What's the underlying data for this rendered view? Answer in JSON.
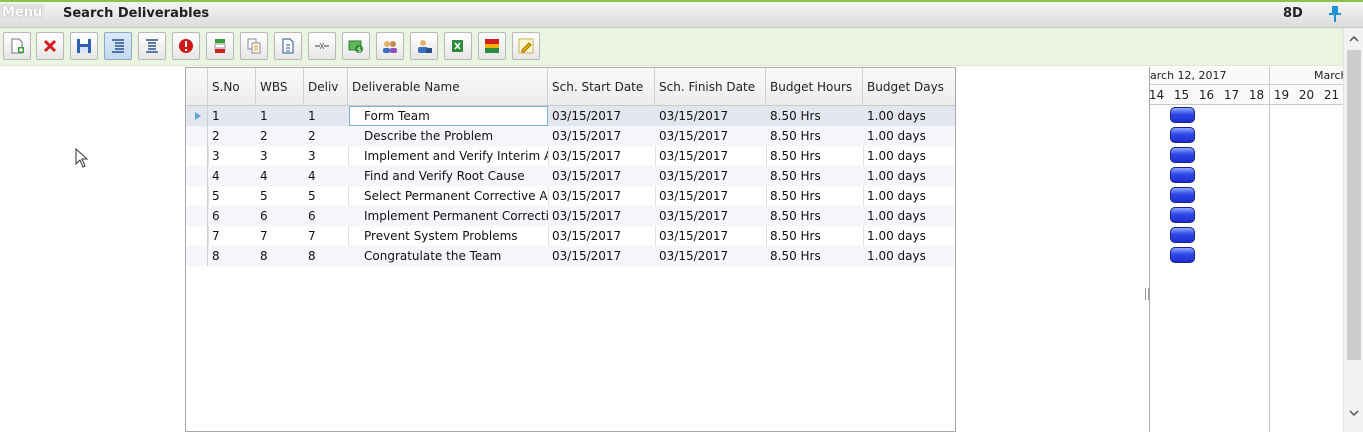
{
  "titlebar": {
    "menu_label": "Menu",
    "title": "Search Deliverables",
    "module": "8D"
  },
  "toolbar": {
    "buttons": [
      {
        "name": "new-icon"
      },
      {
        "name": "delete-icon"
      },
      {
        "name": "save-icon"
      },
      {
        "name": "indent-icon"
      },
      {
        "name": "outdent-icon"
      },
      {
        "name": "alert-icon"
      },
      {
        "name": "insert-row-icon"
      },
      {
        "name": "copy-icon"
      },
      {
        "name": "document-icon"
      },
      {
        "name": "link-icon"
      },
      {
        "name": "money-icon"
      },
      {
        "name": "team-icon"
      },
      {
        "name": "assign-user-icon"
      },
      {
        "name": "export-icon"
      },
      {
        "name": "color-legend-icon"
      },
      {
        "name": "edit-icon"
      }
    ]
  },
  "grid": {
    "columns": [
      "S.No",
      "WBS",
      "Deliv",
      "Deliverable Name",
      "Sch. Start Date",
      "Sch. Finish Date",
      "Budget Hours",
      "Budget Days"
    ],
    "rows": [
      {
        "sno": "1",
        "wbs": "1",
        "deliv": "1",
        "name": "Form Team",
        "start": "03/15/2017",
        "finish": "03/15/2017",
        "hours": "8.50 Hrs",
        "days": "1.00 days"
      },
      {
        "sno": "2",
        "wbs": "2",
        "deliv": "2",
        "name": "Describe the Problem",
        "start": "03/15/2017",
        "finish": "03/15/2017",
        "hours": "8.50 Hrs",
        "days": "1.00 days"
      },
      {
        "sno": "3",
        "wbs": "3",
        "deliv": "3",
        "name": "Implement and Verify Interim Ac",
        "start": "03/15/2017",
        "finish": "03/15/2017",
        "hours": "8.50 Hrs",
        "days": "1.00 days"
      },
      {
        "sno": "4",
        "wbs": "4",
        "deliv": "4",
        "name": "Find and Verify Root Cause",
        "start": "03/15/2017",
        "finish": "03/15/2017",
        "hours": "8.50 Hrs",
        "days": "1.00 days"
      },
      {
        "sno": "5",
        "wbs": "5",
        "deliv": "5",
        "name": "Select Permanent Corrective Act",
        "start": "03/15/2017",
        "finish": "03/15/2017",
        "hours": "8.50 Hrs",
        "days": "1.00 days"
      },
      {
        "sno": "6",
        "wbs": "6",
        "deliv": "6",
        "name": "Implement Permanent Correctiv",
        "start": "03/15/2017",
        "finish": "03/15/2017",
        "hours": "8.50 Hrs",
        "days": "1.00 days"
      },
      {
        "sno": "7",
        "wbs": "7",
        "deliv": "7",
        "name": "Prevent System Problems",
        "start": "03/15/2017",
        "finish": "03/15/2017",
        "hours": "8.50 Hrs",
        "days": "1.00 days"
      },
      {
        "sno": "8",
        "wbs": "8",
        "deliv": "8",
        "name": "Congratulate the Team",
        "start": "03/15/2017",
        "finish": "03/15/2017",
        "hours": "8.50 Hrs",
        "days": "1.00 days"
      }
    ]
  },
  "gantt": {
    "week1_label": "arch 12, 2017",
    "week2_label": "March",
    "days": [
      "14",
      "15",
      "16",
      "17",
      "18",
      "19",
      "20",
      "21"
    ],
    "bar_color": "#1b2fcf"
  },
  "colors": {
    "accent": "#8bc34a",
    "toolbar_bg": "#eaf4e1",
    "pin": "#1e90d6"
  }
}
